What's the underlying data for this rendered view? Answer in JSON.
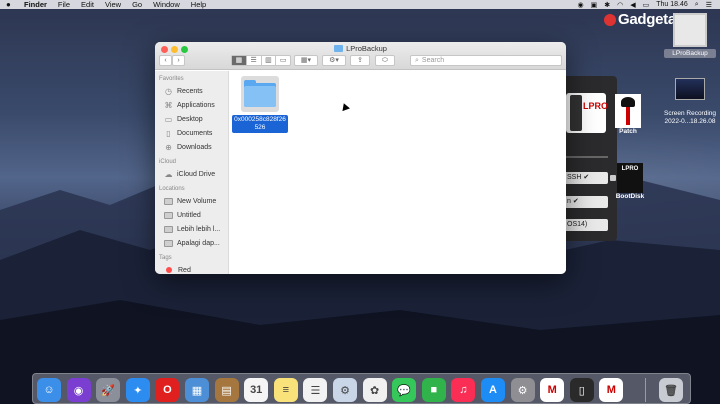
{
  "menubar": {
    "app_name": "Finder",
    "items": [
      "File",
      "Edit",
      "View",
      "Go",
      "Window",
      "Help"
    ],
    "clock": "Thu 18.46"
  },
  "watermark": {
    "text": "Gadgetadia"
  },
  "desktop": {
    "lprobackup_label": "LProBackup",
    "recording_label_line1": "Screen Recording",
    "recording_label_line2": "2022-0...18.26.08",
    "patch_label": "Patch",
    "bootdisk_label": "BootDisk"
  },
  "background_app": {
    "logo_text": "LPRO",
    "bar1": "SSH ✔",
    "bar2": "n ✔",
    "bar3": "OS14)"
  },
  "finder": {
    "title": "LProBackup",
    "search_placeholder": "Search",
    "sidebar": {
      "favorites_header": "Favorites",
      "favorites": [
        {
          "label": "Recents",
          "icon": "clock-icon"
        },
        {
          "label": "Applications",
          "icon": "applications-icon"
        },
        {
          "label": "Desktop",
          "icon": "desktop-icon"
        },
        {
          "label": "Documents",
          "icon": "document-icon"
        },
        {
          "label": "Downloads",
          "icon": "download-icon"
        }
      ],
      "icloud_header": "iCloud",
      "icloud": [
        {
          "label": "iCloud Drive",
          "icon": "cloud-icon"
        }
      ],
      "locations_header": "Locations",
      "locations": [
        {
          "label": "New Volume",
          "icon": "disk-icon"
        },
        {
          "label": "Untitled",
          "icon": "disk-icon"
        },
        {
          "label": "Lebih lebih l...",
          "icon": "disk-icon"
        },
        {
          "label": "Apalagi dap...",
          "icon": "disk-icon"
        }
      ],
      "tags_header": "Tags",
      "tags": [
        {
          "label": "Red",
          "color": "#ff4d4d"
        }
      ]
    },
    "items": [
      {
        "name": "0x000258c828f26526",
        "type": "folder",
        "selected": true
      }
    ]
  },
  "dock": {
    "apps": [
      {
        "name": "finder-icon",
        "color": "#3b8fe8",
        "glyph": "☺"
      },
      {
        "name": "siri-icon",
        "color": "#7a3fd0",
        "glyph": "◉"
      },
      {
        "name": "launchpad-icon",
        "color": "#8a8f99",
        "glyph": "🚀"
      },
      {
        "name": "safari-icon",
        "color": "#2d8cf0",
        "glyph": "✦"
      },
      {
        "name": "opera-icon",
        "color": "#e0201f",
        "glyph": "O"
      },
      {
        "name": "preview-icon",
        "color": "#4d8fd6",
        "glyph": "▦"
      },
      {
        "name": "notebook-icon",
        "color": "#a5773f",
        "glyph": "▤"
      },
      {
        "name": "calendar-icon",
        "color": "#f5f5f5",
        "glyph": "31"
      },
      {
        "name": "notes-icon",
        "color": "#f9e27a",
        "glyph": "≡"
      },
      {
        "name": "reminders-icon",
        "color": "#f2f2f2",
        "glyph": "☰"
      },
      {
        "name": "utility-icon",
        "color": "#c9d6e8",
        "glyph": "⚙"
      },
      {
        "name": "photos-icon",
        "color": "#f0f0f0",
        "glyph": "✿"
      },
      {
        "name": "messages-icon",
        "color": "#35c759",
        "glyph": "💬"
      },
      {
        "name": "facetime-icon",
        "color": "#2fb34a",
        "glyph": "■"
      },
      {
        "name": "music-icon",
        "color": "#fa2d55",
        "glyph": "♫"
      },
      {
        "name": "app-store-icon",
        "color": "#1e8cf5",
        "glyph": "A"
      },
      {
        "name": "system-preferences-icon",
        "color": "#8e8e93",
        "glyph": "⚙"
      },
      {
        "name": "lpro-app-icon",
        "color": "#ffffff",
        "glyph": "M"
      },
      {
        "name": "lpro-backup-app-icon",
        "color": "#2a2a2a",
        "glyph": "▯"
      },
      {
        "name": "lpro-tool-icon",
        "color": "#ffffff",
        "glyph": "M"
      },
      {
        "name": "trash-icon",
        "color": "#c8ccd2",
        "glyph": "🗑"
      }
    ]
  }
}
